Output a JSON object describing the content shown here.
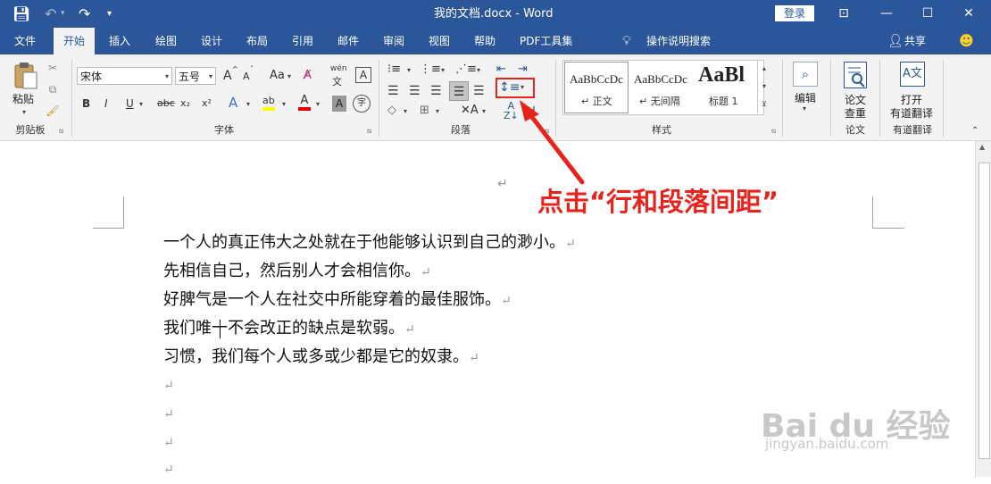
{
  "titlebar": {
    "doc_title": "我的文档.docx  -  Word",
    "login_label": "登录",
    "minimize_glyph": "—",
    "maximize_glyph": "☐",
    "close_glyph": "✕",
    "ribbon_opts_glyph": "⊡"
  },
  "tabs": {
    "file": "文件",
    "home": "开始",
    "insert": "插入",
    "draw": "绘图",
    "design": "设计",
    "layout": "布局",
    "references": "引用",
    "mailings": "邮件",
    "review": "审阅",
    "view": "视图",
    "help": "帮助",
    "pdf": "PDF工具集",
    "tell_me": "操作说明搜索",
    "share": "共享"
  },
  "clipboard": {
    "paste": "粘贴",
    "group_label": "剪贴板"
  },
  "font": {
    "name": "宋体",
    "size": "五号",
    "grow": "A",
    "shrink": "A",
    "case": "Aa",
    "phonetic": "wén",
    "char_border": "A",
    "bold": "B",
    "italic": "I",
    "underline": "U",
    "strikethrough": "abc",
    "subscript": "x₂",
    "superscript": "x²",
    "effects": "A",
    "highlight": "ab",
    "color": "A",
    "shading": "A",
    "enclose": "字",
    "group_label": "字体"
  },
  "paragraph": {
    "group_label": "段落"
  },
  "styles": {
    "preview_normal": "AaBbCcDc",
    "label_normal": "正文",
    "preview_nospacing": "AaBbCcDc",
    "label_nospacing": "无间隔",
    "preview_h1": "AaBl",
    "label_h1": "标题 1",
    "group_label": "样式"
  },
  "editing": {
    "label": "编辑"
  },
  "paper": {
    "check_line1": "论文",
    "check_line2": "查重",
    "group_label": "论文"
  },
  "youdao": {
    "line1": "打开",
    "line2": "有道翻译",
    "group_label": "有道翻译"
  },
  "document": {
    "lines": [
      "一个人的真正伟大之处就在于他能够认识到自己的渺小。",
      "先相信自己，然后别人才会相信你。",
      "好脾气是一个人在社交中所能穿着的最佳服饰。",
      "我们唯一不会改正的缺点是软弱。",
      "习惯，我们每个人或多或少都是它的奴隶。"
    ],
    "para_mark": "↵"
  },
  "annotation": {
    "text": "点击“行和段落间距”",
    "color": "#e8231d"
  },
  "watermark": {
    "brand": "Bai du 经验",
    "url": "jingyan.baidu.com"
  },
  "colors": {
    "word_blue": "#2b579a",
    "ribbon_bg": "#f3f3f3",
    "highlight_yellow": "#ffff00",
    "font_red": "#e00000"
  }
}
